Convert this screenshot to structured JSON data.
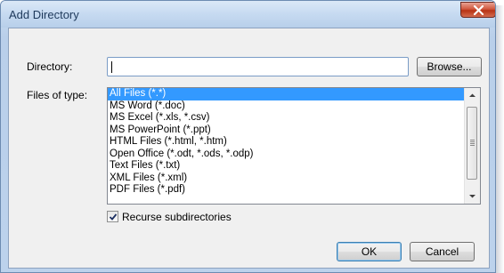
{
  "window": {
    "title": "Add Directory",
    "close_icon": "close-x-icon"
  },
  "directory": {
    "label": "Directory:",
    "value": "",
    "browse_label": "Browse..."
  },
  "files_of_type": {
    "label": "Files of type:",
    "items": [
      "All Files (*.*)",
      "MS Word (*.doc)",
      "MS Excel (*.xls, *.csv)",
      "MS PowerPoint (*.ppt)",
      "HTML Files (*.html, *.htm)",
      "Open Office (*.odt, *.ods, *.odp)",
      "Text Files (*.txt)",
      "XML Files (*.xml)",
      "PDF Files (*.pdf)"
    ],
    "selected": "All Files (*.*)"
  },
  "recurse": {
    "label": "Recurse subdirectories",
    "checked": true
  },
  "buttons": {
    "ok_label": "OK",
    "cancel_label": "Cancel"
  },
  "colors": {
    "selection": "#3399ff",
    "close_button": "#c74b2f",
    "frame": "#bcd2ec"
  }
}
